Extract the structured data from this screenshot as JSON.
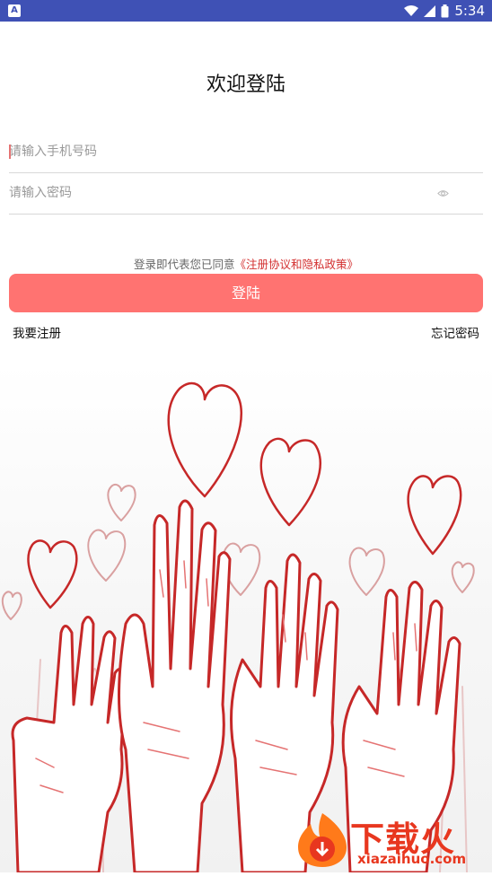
{
  "status_bar": {
    "time": "5:34",
    "left_icon": "A"
  },
  "title": "欢迎登陆",
  "phone": {
    "placeholder": "请输入手机号码",
    "value": ""
  },
  "password": {
    "placeholder": "请输入密码",
    "value": ""
  },
  "agreement": {
    "prefix": "登录即代表您已同意",
    "link": "《注册协议和隐私政策》"
  },
  "login_button": "登陆",
  "register_link": "我要注册",
  "forgot_link": "忘记密码",
  "watermark": {
    "brand": "下载火",
    "domain": "xiazaihuo.com"
  },
  "colors": {
    "status_bar": "#3f51b5",
    "button": "#ff7371",
    "link": "#d32f2f",
    "watermark": "#e8371f"
  }
}
